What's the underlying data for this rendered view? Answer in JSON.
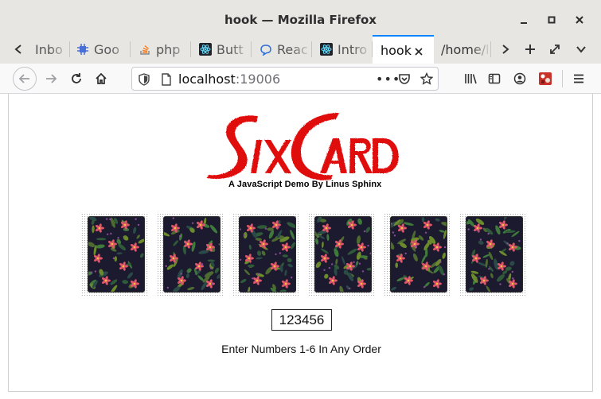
{
  "window": {
    "title": "hook — Mozilla Firefox"
  },
  "tabs": [
    {
      "label": "Inbo",
      "icon": "mail-icon"
    },
    {
      "label": "Goo",
      "icon": "chip-icon"
    },
    {
      "label": "php",
      "icon": "stackoverflow-icon"
    },
    {
      "label": "Butt",
      "icon": "react-icon"
    },
    {
      "label": "Reac",
      "icon": "chat-icon"
    },
    {
      "label": "Intro",
      "icon": "react-icon"
    },
    {
      "label": "hook",
      "icon": "none",
      "active": true
    },
    {
      "label": "/home/l",
      "icon": "none"
    }
  ],
  "nav": {
    "url_host": "localhost",
    "url_port": ":19006"
  },
  "page": {
    "logo_text": "SIX CARD",
    "subtitle": "A JavaScript Demo By Linus Sphinx",
    "input_value": "123456",
    "instruction": "Enter Numbers 1-6 In Any Order",
    "card_count": 6
  },
  "colors": {
    "logo_red": "#e01010",
    "accent": "#0a84ff"
  }
}
